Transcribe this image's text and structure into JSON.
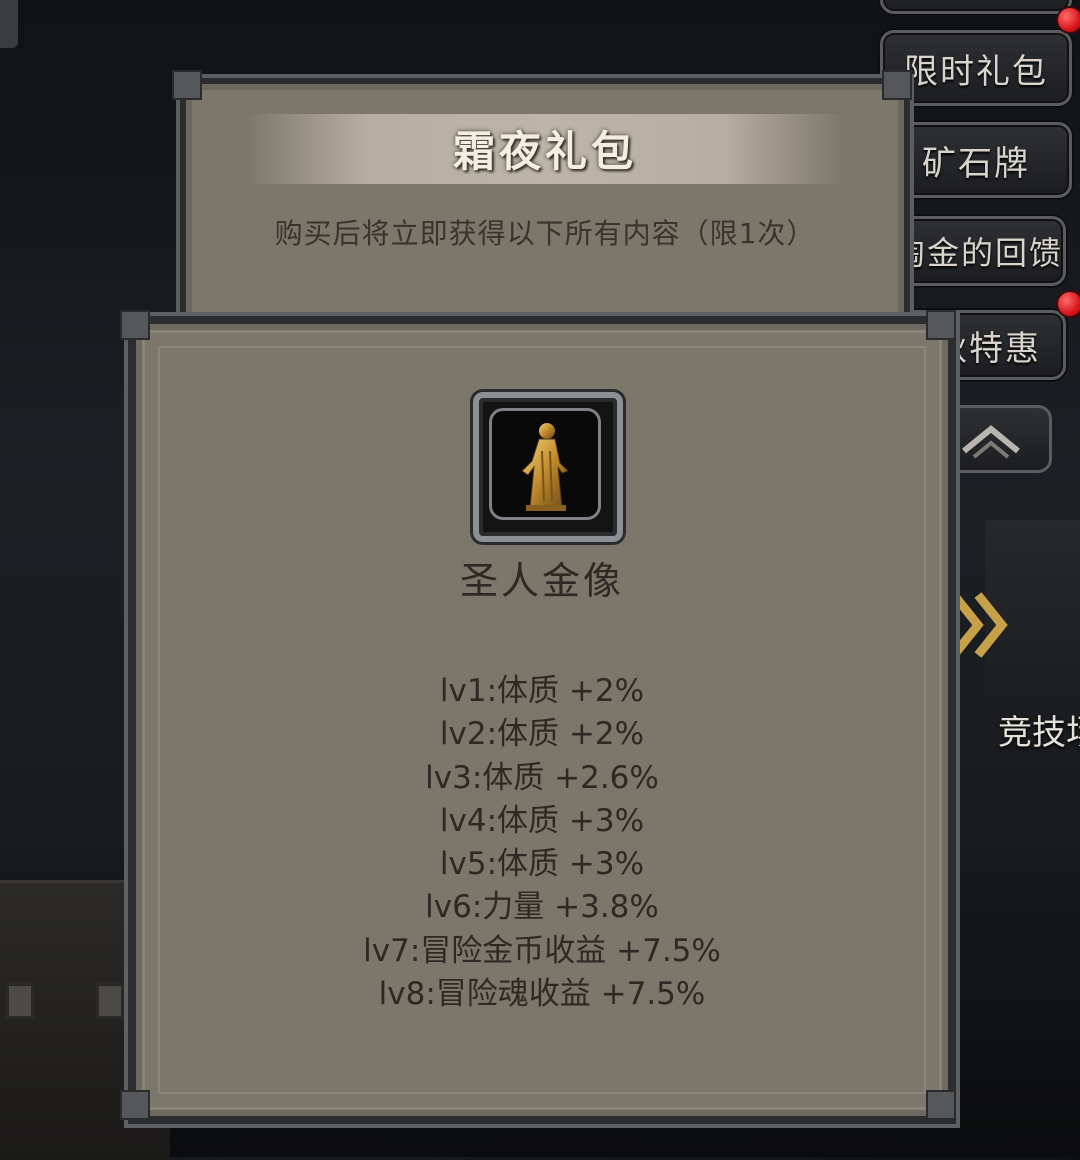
{
  "side_menu": {
    "items": [
      {
        "label": "限时礼包",
        "badge": true
      },
      {
        "label": "矿石牌",
        "badge": false
      },
      {
        "label": "淘金的回馈",
        "badge": false
      },
      {
        "label": "秋特惠",
        "badge": true
      }
    ],
    "collapse_icon": "chevron-up-icon"
  },
  "map": {
    "arena_label": "竞技场",
    "arrow_icon": "double-chevron-right-icon"
  },
  "gift_pack": {
    "title": "霜夜礼包",
    "description": "购买后将立即获得以下所有内容（限1次）"
  },
  "item_detail": {
    "icon": "golden-saint-statue-icon",
    "name": "圣人金像",
    "levels": [
      "lv1:体质 +2%",
      "lv2:体质 +2%",
      "lv3:体质 +2.6%",
      "lv4:体质 +3%",
      "lv5:体质 +3%",
      "lv6:力量 +3.8%",
      "lv7:冒险金币收益 +7.5%",
      "lv8:冒险魂收益 +7.5%"
    ]
  },
  "colors": {
    "panel": "#7d766b",
    "frame": "#2c2d2f",
    "text_dark": "#2d2924",
    "title_light": "#f3ede3",
    "badge_red": "#d9141b",
    "arrow_gold": "#c7a14a"
  }
}
